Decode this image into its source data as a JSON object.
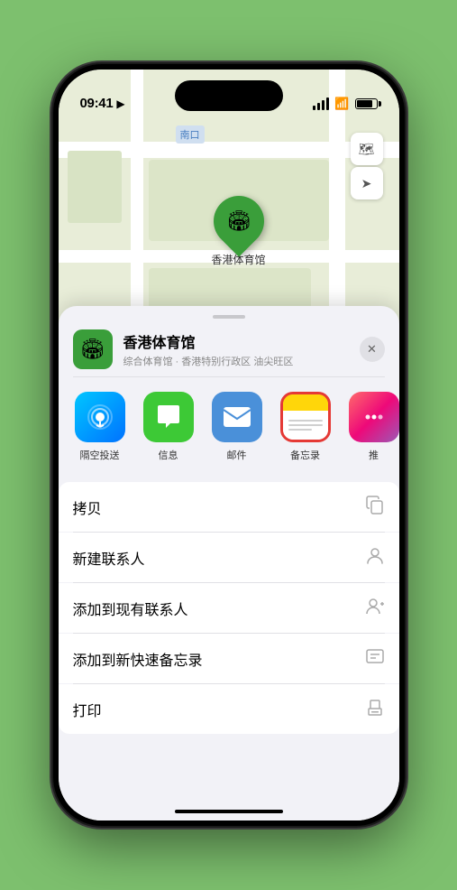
{
  "status_bar": {
    "time": "09:41",
    "location_indicator": "▶"
  },
  "map": {
    "entrance_label": "南口"
  },
  "map_controls": {
    "layers_icon": "🗺",
    "location_icon": "➤"
  },
  "venue": {
    "name": "香港体育馆",
    "description": "综合体育馆 · 香港特别行政区 油尖旺区",
    "pin_label": "香港体育馆"
  },
  "share_items": [
    {
      "id": "airdrop",
      "label": "隔空投送"
    },
    {
      "id": "messages",
      "label": "信息"
    },
    {
      "id": "mail",
      "label": "邮件"
    },
    {
      "id": "notes",
      "label": "备忘录",
      "selected": true
    },
    {
      "id": "more",
      "label": "推"
    }
  ],
  "actions": [
    {
      "label": "拷贝",
      "icon": "⎘"
    },
    {
      "label": "新建联系人",
      "icon": "👤"
    },
    {
      "label": "添加到现有联系人",
      "icon": "👤+"
    },
    {
      "label": "添加到新快速备忘录",
      "icon": "📝"
    },
    {
      "label": "打印",
      "icon": "🖨"
    }
  ],
  "close_label": "✕"
}
